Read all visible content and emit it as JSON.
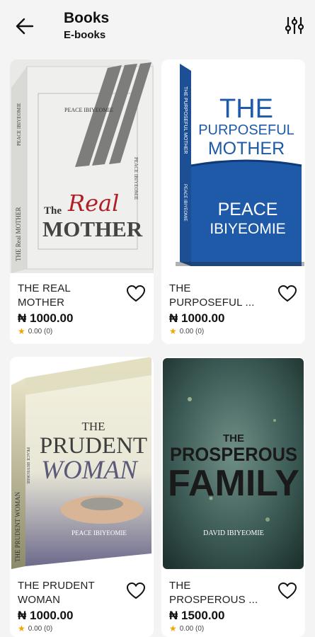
{
  "header": {
    "title": "Books",
    "subtitle": "E-books",
    "back_icon": "arrow-left-icon",
    "filter_icon": "sliders-icon"
  },
  "books": [
    {
      "title_line1": "THE REAL",
      "title_line2": "MOTHER",
      "price": "₦ 1000.00",
      "rating": "0.00 (0)",
      "cover": {
        "author": "PEACE IBIYEOMIE",
        "the": "The",
        "script": "Real",
        "main": "MOTHER",
        "spine": "THE Real MOTHER",
        "spine_author": "PEACE IBIYEOMIE"
      }
    },
    {
      "title_line1": "THE",
      "title_line2": "PURPOSEFUL ...",
      "price": "₦ 1000.00",
      "rating": "0.00 (0)",
      "cover": {
        "line1": "THE",
        "line2": "PURPOSEFUL",
        "line3": "MOTHER",
        "author1": "PEACE",
        "author2": "IBIYEOMIE",
        "spine": "THE PURPOSEFUL MOTHER",
        "spine_author": "PEACE IBIYEOMIE"
      }
    },
    {
      "title_line1": "THE PRUDENT",
      "title_line2": "WOMAN",
      "price": "₦ 1000.00",
      "rating": "0.00 (0)",
      "cover": {
        "the": "THE",
        "line1": "PRUDENT",
        "line2": "WOMAN",
        "author": "PEACE IBIYEOMIE",
        "spine": "THE PRUDENT WOMAN",
        "spine_author": "PEACE IBIYEOMIE"
      }
    },
    {
      "title_line1": "THE",
      "title_line2": "PROSPEROUS ...",
      "price": "₦ 1500.00",
      "rating": "0.00 (0)",
      "cover": {
        "the": "THE",
        "line1": "PROSPEROUS",
        "line2": "FAMILY",
        "author": "DAVID IBIYEOMIE"
      }
    }
  ],
  "colors": {
    "accent_blue": "#1e5aa8",
    "star": "#f0a500",
    "real_red": "#b01e24"
  }
}
